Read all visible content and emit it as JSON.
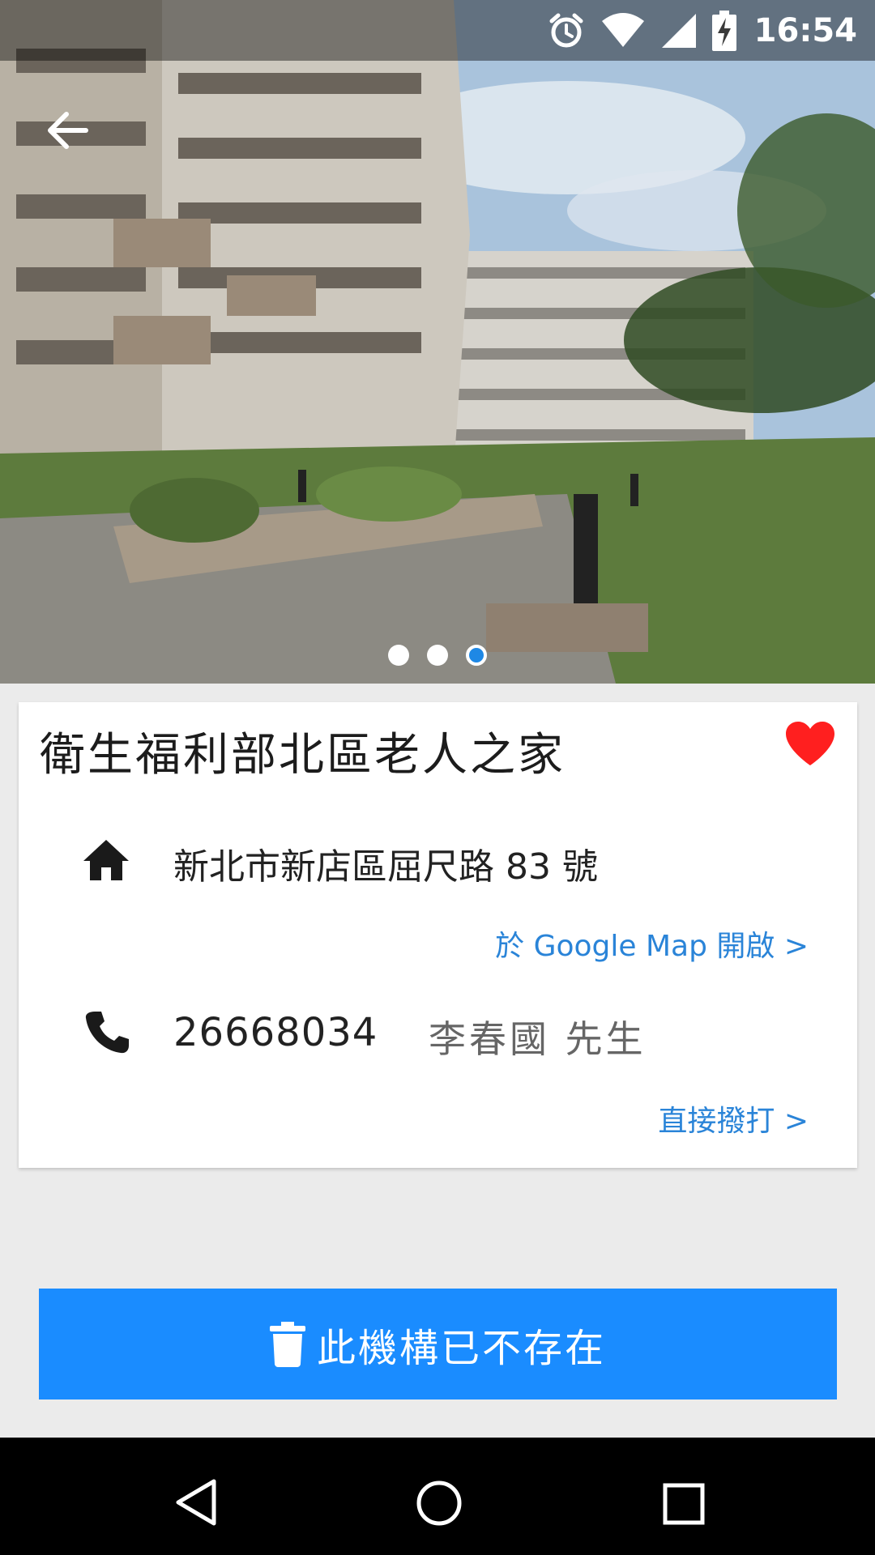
{
  "status_bar": {
    "time": "16:54",
    "icons": [
      "alarm-icon",
      "wifi-icon",
      "signal-icon",
      "battery-charging-icon"
    ]
  },
  "hero": {
    "image": "building-courtyard-photo",
    "carousel_page": 3,
    "carousel_total": 3
  },
  "facility": {
    "name": "衛生福利部北區老人之家",
    "favorited": true,
    "address": "新北市新店區屈尺路 83 號",
    "map_link": "於 Google Map 開啟 >",
    "phone": "26668034",
    "contact": "李春國  先生",
    "call_link": "直接撥打 >"
  },
  "actions": {
    "delete_label": "此機構已不存在"
  },
  "colors": {
    "accent": "#1a8cff",
    "link": "#2a84d8",
    "favorite": "#ff1f1f",
    "background": "#ebebeb"
  }
}
